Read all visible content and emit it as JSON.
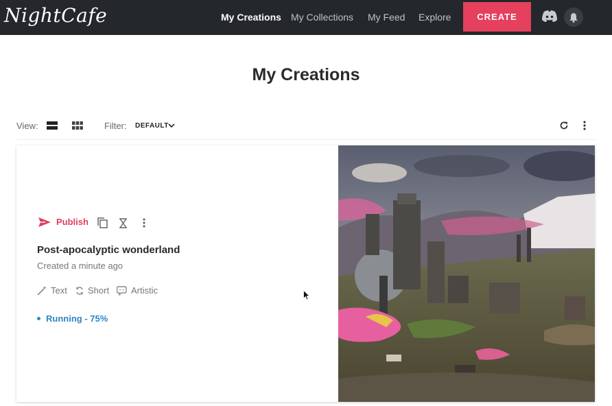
{
  "app": {
    "logo_text": "NightCafe"
  },
  "nav": {
    "links": [
      "My Creations",
      "My Collections",
      "My Feed",
      "Explore"
    ],
    "create_label": "CREATE",
    "accent": "#e5405e"
  },
  "page": {
    "title": "My Creations"
  },
  "toolbar": {
    "view_label": "View:",
    "filter_label": "Filter:",
    "filter_value": "DEFAULT"
  },
  "creation": {
    "publish_label": "Publish",
    "title": "Post-apocalyptic wonderland",
    "created": "Created a minute ago",
    "tags": [
      "Text",
      "Short",
      "Artistic"
    ],
    "status": "Running - 75%"
  },
  "colors": {
    "status": "#2e86c1",
    "publish": "#e03e5d",
    "nav_bg": "#24272b"
  }
}
